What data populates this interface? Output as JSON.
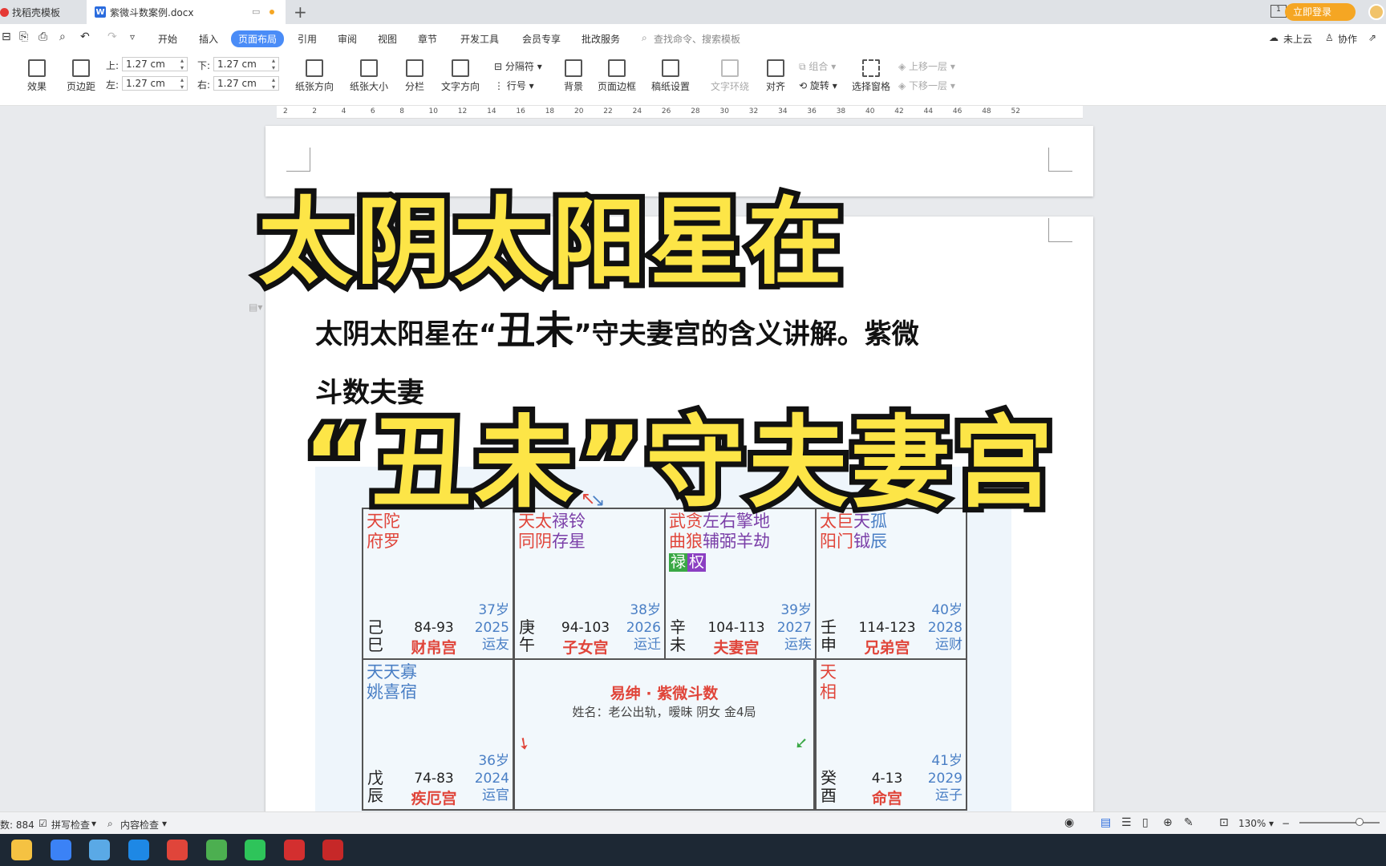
{
  "tabs": [
    {
      "label": "找稻壳模板"
    },
    {
      "label": "紫微斗数案例.docx"
    }
  ],
  "header_right": {
    "login": "立即登录"
  },
  "menu": {
    "items": [
      "开始",
      "插入",
      "页面布局",
      "引用",
      "审阅",
      "视图",
      "章节",
      "开发工具",
      "会员专享",
      "批改服务"
    ],
    "search_placeholder": "查找命令、搜索模板",
    "cloud": "未上云",
    "collab": "协作"
  },
  "ribbon": {
    "effect": "效果",
    "margin": "页边距",
    "top_label": "上:",
    "top_value": "1.27 cm",
    "bottom_label": "下:",
    "bottom_value": "1.27 cm",
    "left_label": "左:",
    "left_value": "1.27 cm",
    "right_label": "右:",
    "right_value": "1.27 cm",
    "orientation": "纸张方向",
    "size": "纸张大小",
    "columns": "分栏",
    "text_direction": "文字方向",
    "breaks": "分隔符",
    "line_numbers": "行号",
    "background": "背景",
    "page_border": "页面边框",
    "manuscript": "稿纸设置",
    "wrap": "文字环绕",
    "align": "对齐",
    "group": "组合",
    "rotate": "旋转",
    "select_pane": "选择窗格",
    "bring_forward": "上移一层",
    "send_backward": "下移一层"
  },
  "ruler_ticks": [
    "2",
    "2",
    "4",
    "6",
    "8",
    "10",
    "12",
    "14",
    "16",
    "18",
    "20",
    "22",
    "24",
    "26",
    "28",
    "30",
    "32",
    "34",
    "36",
    "38",
    "40",
    "42",
    "44",
    "46",
    "48",
    "52"
  ],
  "document": {
    "line1_a": "太阴太阳星在“",
    "line1_big": "丑未",
    "line1_b": "”守夫妻宫的含义讲解。紫微",
    "line2": "斗数夫妻"
  },
  "overlay": {
    "title1": "太阴太阳星在",
    "title2": "“丑未”守夫妻宫"
  },
  "chart_data": {
    "type": "table",
    "center_title": "易绅 · 紫微斗数",
    "center_subtitle": "姓名：老公出轨，暧昧 阴女 金4局",
    "cells": [
      {
        "stars_line1": [
          [
            "天",
            "red"
          ],
          [
            "陀",
            "red"
          ]
        ],
        "stars_line2": [
          [
            "府",
            "red"
          ],
          [
            "罗",
            "red"
          ]
        ],
        "stem": "己",
        "branch": "巳",
        "range": "84-93",
        "age": "37岁",
        "year": "2025",
        "palace": "财帛宫",
        "yun": "运友"
      },
      {
        "stars_line1": [
          [
            "天",
            "red"
          ],
          [
            "太",
            "red"
          ],
          [
            "禄",
            "purple"
          ],
          [
            "铃",
            "purple"
          ]
        ],
        "stars_line2": [
          [
            "同",
            "red"
          ],
          [
            "阴",
            "red"
          ],
          [
            "存",
            "purple"
          ],
          [
            "星",
            "purple"
          ]
        ],
        "stem": "庚",
        "branch": "午",
        "range": "94-103",
        "age": "38岁",
        "year": "2026",
        "palace": "子女宫",
        "yun": "运迁"
      },
      {
        "stars_line1": [
          [
            "武",
            "red"
          ],
          [
            "贪",
            "red"
          ],
          [
            "左",
            "purple"
          ],
          [
            "右",
            "purple"
          ],
          [
            "擎",
            "purple"
          ],
          [
            "地",
            "purple"
          ]
        ],
        "stars_line2": [
          [
            "曲",
            "red"
          ],
          [
            "狼",
            "red"
          ],
          [
            "辅",
            "purple"
          ],
          [
            "弼",
            "purple"
          ],
          [
            "羊",
            "purple"
          ],
          [
            "劫",
            "purple"
          ]
        ],
        "badges": [
          "禄",
          "权"
        ],
        "stem": "辛",
        "branch": "未",
        "range": "104-113",
        "age": "39岁",
        "year": "2027",
        "palace": "夫妻宫",
        "yun": "运疾"
      },
      {
        "stars_line1": [
          [
            "太",
            "red"
          ],
          [
            "巨",
            "red"
          ],
          [
            "天",
            "purple"
          ],
          [
            "孤",
            "blue"
          ]
        ],
        "stars_line2": [
          [
            "阳",
            "red"
          ],
          [
            "门",
            "red"
          ],
          [
            "钺",
            "purple"
          ],
          [
            "辰",
            "blue"
          ]
        ],
        "stem": "壬",
        "branch": "申",
        "range": "114-123",
        "age": "40岁",
        "year": "2028",
        "palace": "兄弟宫",
        "yun": "运财"
      },
      {
        "stars_line1": [
          [
            "天",
            "blue"
          ],
          [
            "天",
            "blue"
          ],
          [
            "寡",
            "blue"
          ]
        ],
        "stars_line2": [
          [
            "姚",
            "blue"
          ],
          [
            "喜",
            "blue"
          ],
          [
            "宿",
            "blue"
          ]
        ],
        "stem": "戊",
        "branch": "辰",
        "range": "74-83",
        "age": "36岁",
        "year": "2024",
        "palace": "疾厄宫",
        "yun": "运官"
      },
      {
        "stars_line1": [
          [
            "天",
            "red"
          ]
        ],
        "stars_line2": [
          [
            "相",
            "red"
          ]
        ],
        "stem": "癸",
        "branch": "酉",
        "range": "4-13",
        "age": "41岁",
        "year": "2029",
        "palace": "命宫",
        "yun": "运子"
      }
    ]
  },
  "colors": {
    "accent": "#4a8cf7",
    "star_red": "#e0453a",
    "star_blue": "#4a7fc5",
    "star_purple": "#7b3fa8",
    "overlay_fill": "#fde547",
    "badge_green": "#3aa845",
    "badge_purple": "#8b3fc2"
  },
  "status": {
    "word_count": "数: 884",
    "spell": "拼写检查",
    "content_check": "内容检查",
    "zoom": "130%"
  },
  "taskbar_apps": [
    "file-explorer-icon",
    "store-icon",
    "notes-icon",
    "mail-icon",
    "photos-icon",
    "chrome-icon",
    "wechat-icon",
    "wps-icon",
    "recorder-icon"
  ]
}
